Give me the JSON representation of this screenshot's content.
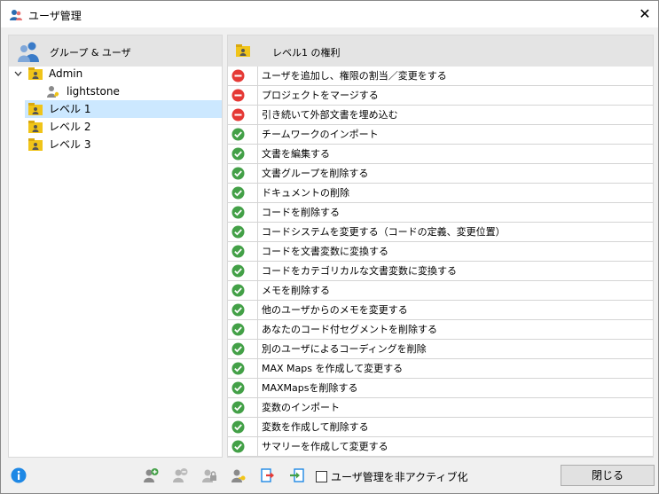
{
  "window": {
    "title": "ユーザ管理",
    "close_glyph": "✕"
  },
  "left_pane": {
    "header": "グループ & ユーザ",
    "tree": [
      {
        "label": "Admin",
        "level": 0,
        "expanded": true,
        "type": "group",
        "selected": false
      },
      {
        "label": "lightstone",
        "level": 1,
        "type": "user",
        "selected": false
      },
      {
        "label": "レベル 1",
        "level": 0,
        "type": "group",
        "selected": true
      },
      {
        "label": "レベル 2",
        "level": 0,
        "type": "group",
        "selected": false
      },
      {
        "label": "レベル 3",
        "level": 0,
        "type": "group",
        "selected": false
      }
    ]
  },
  "right_pane": {
    "header": "レベル1 の権利",
    "rights": [
      {
        "label": "ユーザを追加し、権限の割当／変更をする",
        "allowed": false
      },
      {
        "label": "プロジェクトをマージする",
        "allowed": false
      },
      {
        "label": "引き続いて外部文書を埋め込む",
        "allowed": false
      },
      {
        "label": "チームワークのインポート",
        "allowed": true
      },
      {
        "label": "文書を編集する",
        "allowed": true
      },
      {
        "label": "文書グループを削除する",
        "allowed": true
      },
      {
        "label": "ドキュメントの削除",
        "allowed": true
      },
      {
        "label": "コードを削除する",
        "allowed": true
      },
      {
        "label": "コードシステムを変更する（コードの定義、変更位置）",
        "allowed": true
      },
      {
        "label": "コードを文書変数に変換する",
        "allowed": true
      },
      {
        "label": "コードをカテゴリカルな文書変数に変換する",
        "allowed": true
      },
      {
        "label": "メモを削除する",
        "allowed": true
      },
      {
        "label": "他のユーザからのメモを変更する",
        "allowed": true
      },
      {
        "label": "あなたのコード付セグメントを削除する",
        "allowed": true
      },
      {
        "label": "別のユーザによるコーディングを削除",
        "allowed": true
      },
      {
        "label": "MAX Maps を作成して変更する",
        "allowed": true
      },
      {
        "label": "MAXMapsを削除する",
        "allowed": true
      },
      {
        "label": "変数のインポート",
        "allowed": true
      },
      {
        "label": "変数を作成して削除する",
        "allowed": true
      },
      {
        "label": "サマリーを作成して変更する",
        "allowed": true
      }
    ]
  },
  "bottom_bar": {
    "toolbar_icons": [
      "info-icon",
      "add-user-icon",
      "remove-user-icon",
      "lock-icon",
      "user-key-icon",
      "export-icon",
      "import-icon"
    ],
    "deactivate_label": "ユーザ管理を非アクティブ化",
    "deactivate_checked": false,
    "close_label": "閉じる"
  },
  "colors": {
    "deny": "#e53935",
    "allow": "#43a047",
    "selection": "#cce8ff",
    "folder": "#f0c419",
    "info": "#1e88e5"
  }
}
